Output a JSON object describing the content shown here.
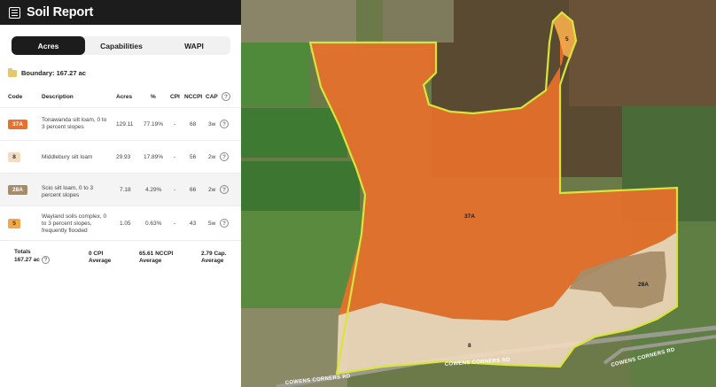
{
  "app": {
    "title": "Soil Report",
    "title_icon": "report-icon"
  },
  "tabs": [
    {
      "label": "Acres",
      "active": true
    },
    {
      "label": "Capabilities",
      "active": false
    },
    {
      "label": "WAPI",
      "active": false
    }
  ],
  "boundary": {
    "label": "Boundary: 167.27 ac",
    "icon": "folder-icon"
  },
  "table": {
    "headers": {
      "code": "Code",
      "description": "Description",
      "acres": "Acres",
      "percent": "%",
      "cpi": "CPI",
      "nccpi": "NCCPI",
      "cap": "CAP"
    },
    "rows": [
      {
        "code": "37A",
        "color": "#e8702a",
        "text_color": "#ffffff",
        "description": "Tonawanda silt loam, 0 to 3 percent slopes",
        "acres": "129.11",
        "percent": "77.19%",
        "cpi": "-",
        "nccpi": "68",
        "cap": "3w"
      },
      {
        "code": "8",
        "color": "#f5dcc0",
        "text_color": "#333333",
        "description": "Middlebury silt loam",
        "acres": "29.93",
        "percent": "17.89%",
        "cpi": "-",
        "nccpi": "56",
        "cap": "2w"
      },
      {
        "code": "28A",
        "color": "#a88c68",
        "text_color": "#ffffff",
        "description": "Scio silt loam, 0 to 3 percent slopes",
        "acres": "7.18",
        "percent": "4.29%",
        "cpi": "-",
        "nccpi": "66",
        "cap": "2w"
      },
      {
        "code": "5",
        "color": "#f0a84a",
        "text_color": "#333333",
        "description": "Wayland soils complex, 0 to 3 percent slopes, frequently flooded",
        "acres": "1.05",
        "percent": "0.63%",
        "cpi": "-",
        "nccpi": "43",
        "cap": "5w"
      }
    ]
  },
  "totals": {
    "label": "Totals",
    "acres": "167.27 ac",
    "cpi_value": "0 CPI",
    "cpi_sub": "Average",
    "nccpi_value": "65.61 NCCPI",
    "nccpi_sub": "Average",
    "cap_value": "2.79 Cap.",
    "cap_sub": "Average"
  },
  "map": {
    "unit_labels": {
      "u37a": "37A",
      "u28a": "28A",
      "u8": "8",
      "u5": "5"
    },
    "roads": {
      "top": "COWENS CORNERS RD",
      "bottom": "COWENS CORNERS RD",
      "right": "COWENS CORNERS RD"
    },
    "colors": {
      "unit37a": "#e8702a",
      "unit8": "#f5dcc0",
      "unit28a": "#a88c68",
      "unit5": "#f0a84a",
      "boundary": "#d8e63a"
    }
  }
}
